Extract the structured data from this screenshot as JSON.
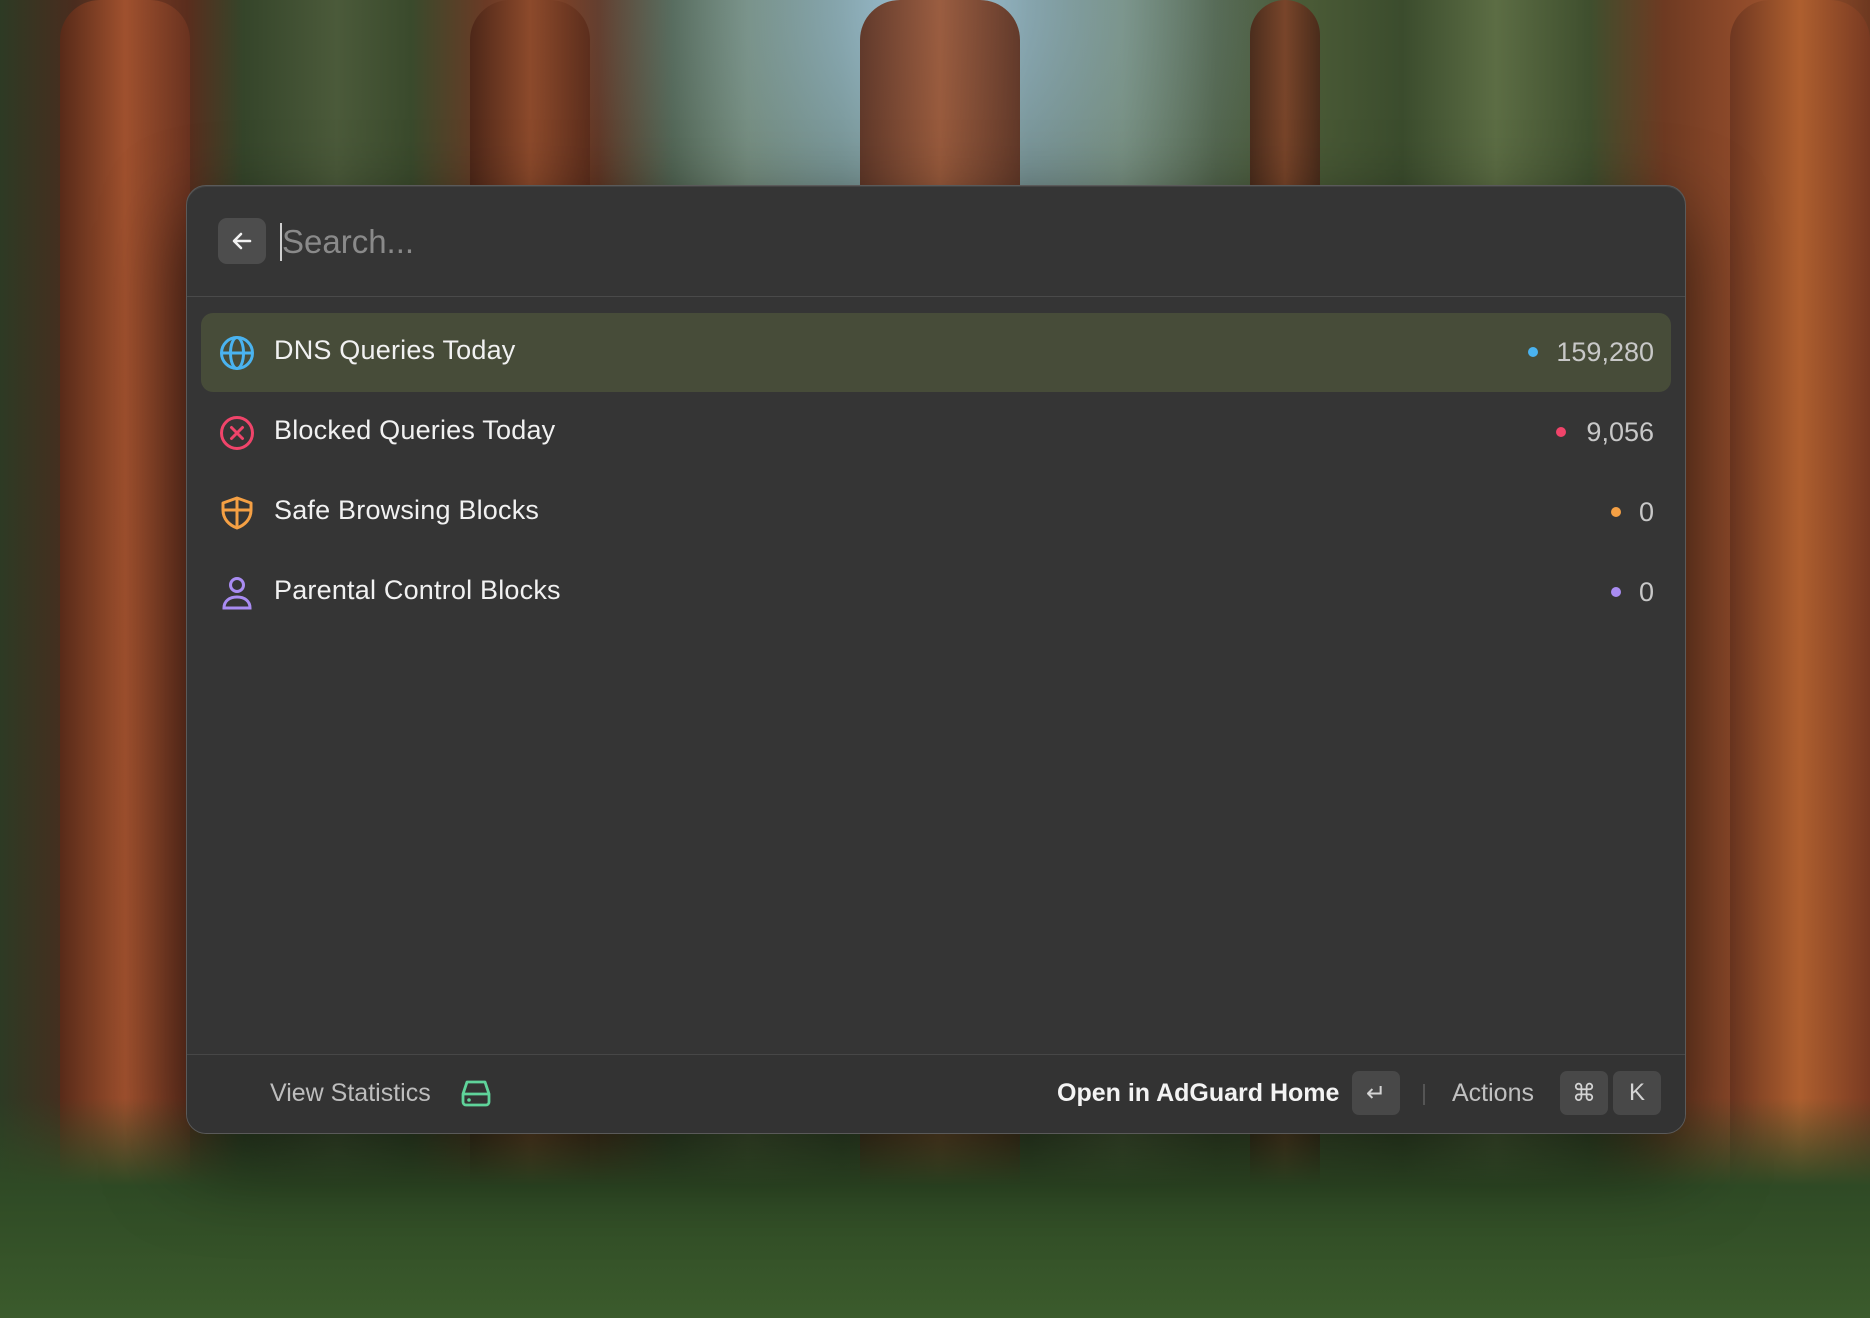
{
  "search": {
    "placeholder": "Search..."
  },
  "rows": [
    {
      "label": "DNS Queries Today",
      "value": "159,280",
      "icon": "globe-icon",
      "color": "#4ab3f0",
      "selected": true
    },
    {
      "label": "Blocked Queries Today",
      "value": "9,056",
      "icon": "x-circle-icon",
      "color": "#f0446a",
      "selected": false
    },
    {
      "label": "Safe Browsing Blocks",
      "value": "0",
      "icon": "shield-icon",
      "color": "#f5a044",
      "selected": false
    },
    {
      "label": "Parental Control Blocks",
      "value": "0",
      "icon": "person-icon",
      "color": "#a98cf2",
      "selected": false
    }
  ],
  "footer": {
    "view_label": "View Statistics",
    "view_icon": "hard-drive-icon",
    "view_icon_color": "#5fd39a",
    "primary_action": "Open in AdGuard Home",
    "enter_key": "↵",
    "actions_label": "Actions",
    "cmd_key": "⌘",
    "k_key": "K"
  }
}
